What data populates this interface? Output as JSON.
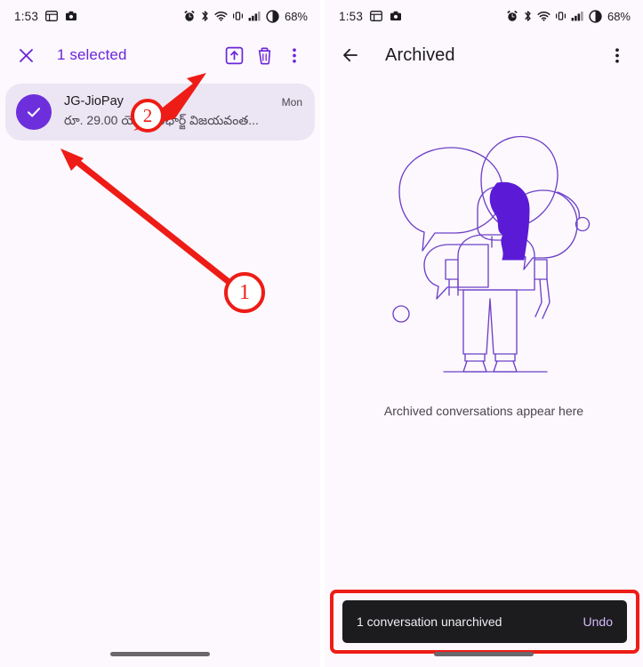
{
  "status_bar": {
    "time": "1:53",
    "battery_percent": "68%",
    "icons": [
      "screenshot-icon",
      "camera-icon",
      "alarm-icon",
      "bluetooth-icon",
      "wifi-icon",
      "vibrate-icon",
      "signal-icon",
      "battery-saver-icon"
    ]
  },
  "left_screen": {
    "appbar": {
      "close_label": "close-icon",
      "title": "1 selected",
      "actions": [
        {
          "name": "unarchive-button",
          "icon": "unarchive-icon"
        },
        {
          "name": "delete-button",
          "icon": "trash-icon"
        },
        {
          "name": "overflow-button",
          "icon": "more-vert-icon"
        }
      ]
    },
    "conversation": {
      "sender": "JG-JioPay",
      "snippet": "రూ. 29.00 యొక్క రీఛార్జ్ విజయవంత...",
      "timestamp": "Mon",
      "selected": true,
      "avatar_icon": "check-icon"
    }
  },
  "right_screen": {
    "appbar": {
      "back_label": "back-arrow-icon",
      "title": "Archived",
      "actions": [
        {
          "name": "overflow-button",
          "icon": "more-vert-icon"
        }
      ]
    },
    "empty_state": {
      "illustration": "person-with-speech-bubbles-illustration",
      "message": "Archived conversations appear here"
    },
    "snackbar": {
      "message": "1 conversation unarchived",
      "action_label": "Undo"
    }
  },
  "annotations": {
    "step_one": "1",
    "step_two": "2",
    "highlight_color": "#ee1c16"
  },
  "colors": {
    "accent_purple": "#6b26d9",
    "avatar_purple": "#6d2fdb",
    "selected_row_bg": "#ece5f3",
    "screen_bg": "#fdf8fd",
    "snackbar_bg": "#1c1b1e",
    "snackbar_action": "#d6bbfb",
    "annotation_red": "#ee1c16"
  }
}
